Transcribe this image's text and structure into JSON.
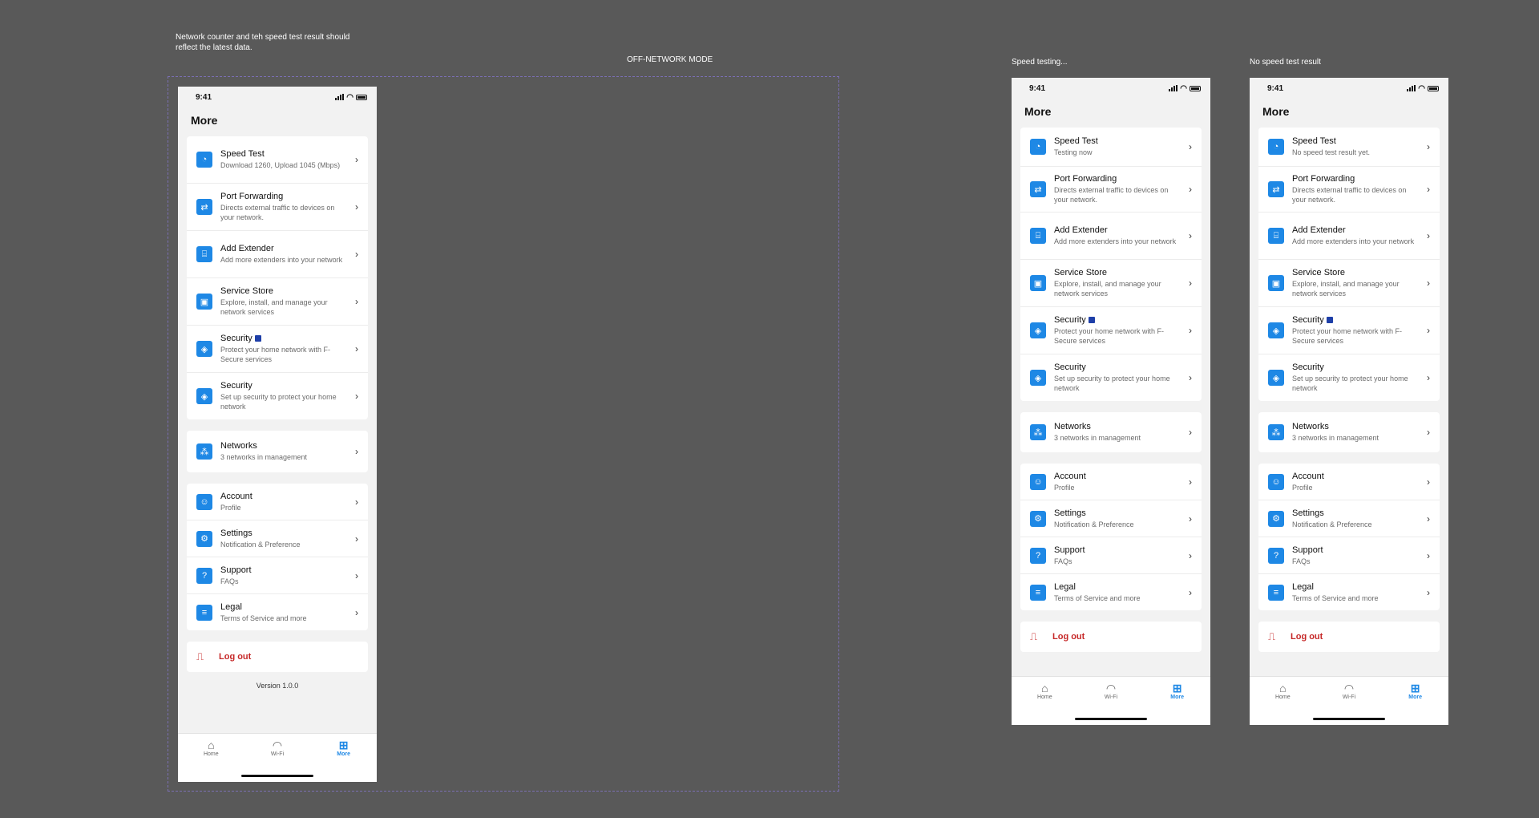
{
  "notes": {
    "top_left": "Network counter and teh speed test result should reflect the latest data.",
    "mode_title": "OFF-NETWORK MODE",
    "caption_testing": "Speed testing...",
    "caption_no_result": "No speed test result"
  },
  "status": {
    "time": "9:41"
  },
  "page": {
    "title": "More"
  },
  "menu": {
    "speed_test": "Speed Test",
    "port_forwarding": "Port Forwarding",
    "port_forwarding_sub": "Directs external traffic to devices on your network.",
    "add_extender": "Add Extender",
    "add_extender_sub": "Add more extenders into your network",
    "service_store": "Service Store",
    "service_store_sub": "Explore, install, and manage your network services",
    "security": "Security",
    "security_fsecure_sub": "Protect your home network with F-Secure services",
    "security_setup_sub": "Set up security to protect your home network",
    "networks": "Networks",
    "networks_sub": "3 networks in management",
    "account": "Account",
    "account_sub": "Profile",
    "settings": "Settings",
    "settings_sub": "Notification & Preference",
    "support": "Support",
    "support_sub": "FAQs",
    "legal": "Legal",
    "legal_sub": "Terms of Service and more",
    "logout": "Log out"
  },
  "speed_subs": {
    "result": "Download 1260, Upload 1045 (Mbps)",
    "testing": "Testing now",
    "none": "No speed test result yet."
  },
  "version": "Version 1.0.0",
  "tabs": {
    "home": "Home",
    "wifi": "Wi-Fi",
    "more": "More"
  },
  "icons": {
    "speed": "speedometer-icon",
    "port": "shuffle-icon",
    "extender": "router-icon",
    "store": "store-icon",
    "security": "shield-icon",
    "networks": "network-icon",
    "account": "person-icon",
    "settings": "gear-icon",
    "support": "help-icon",
    "legal": "document-icon",
    "logout": "door-icon",
    "chevron": "chevron-right-icon"
  },
  "colors": {
    "accent": "#1e88e5",
    "danger": "#c62828",
    "background": "#595959"
  }
}
